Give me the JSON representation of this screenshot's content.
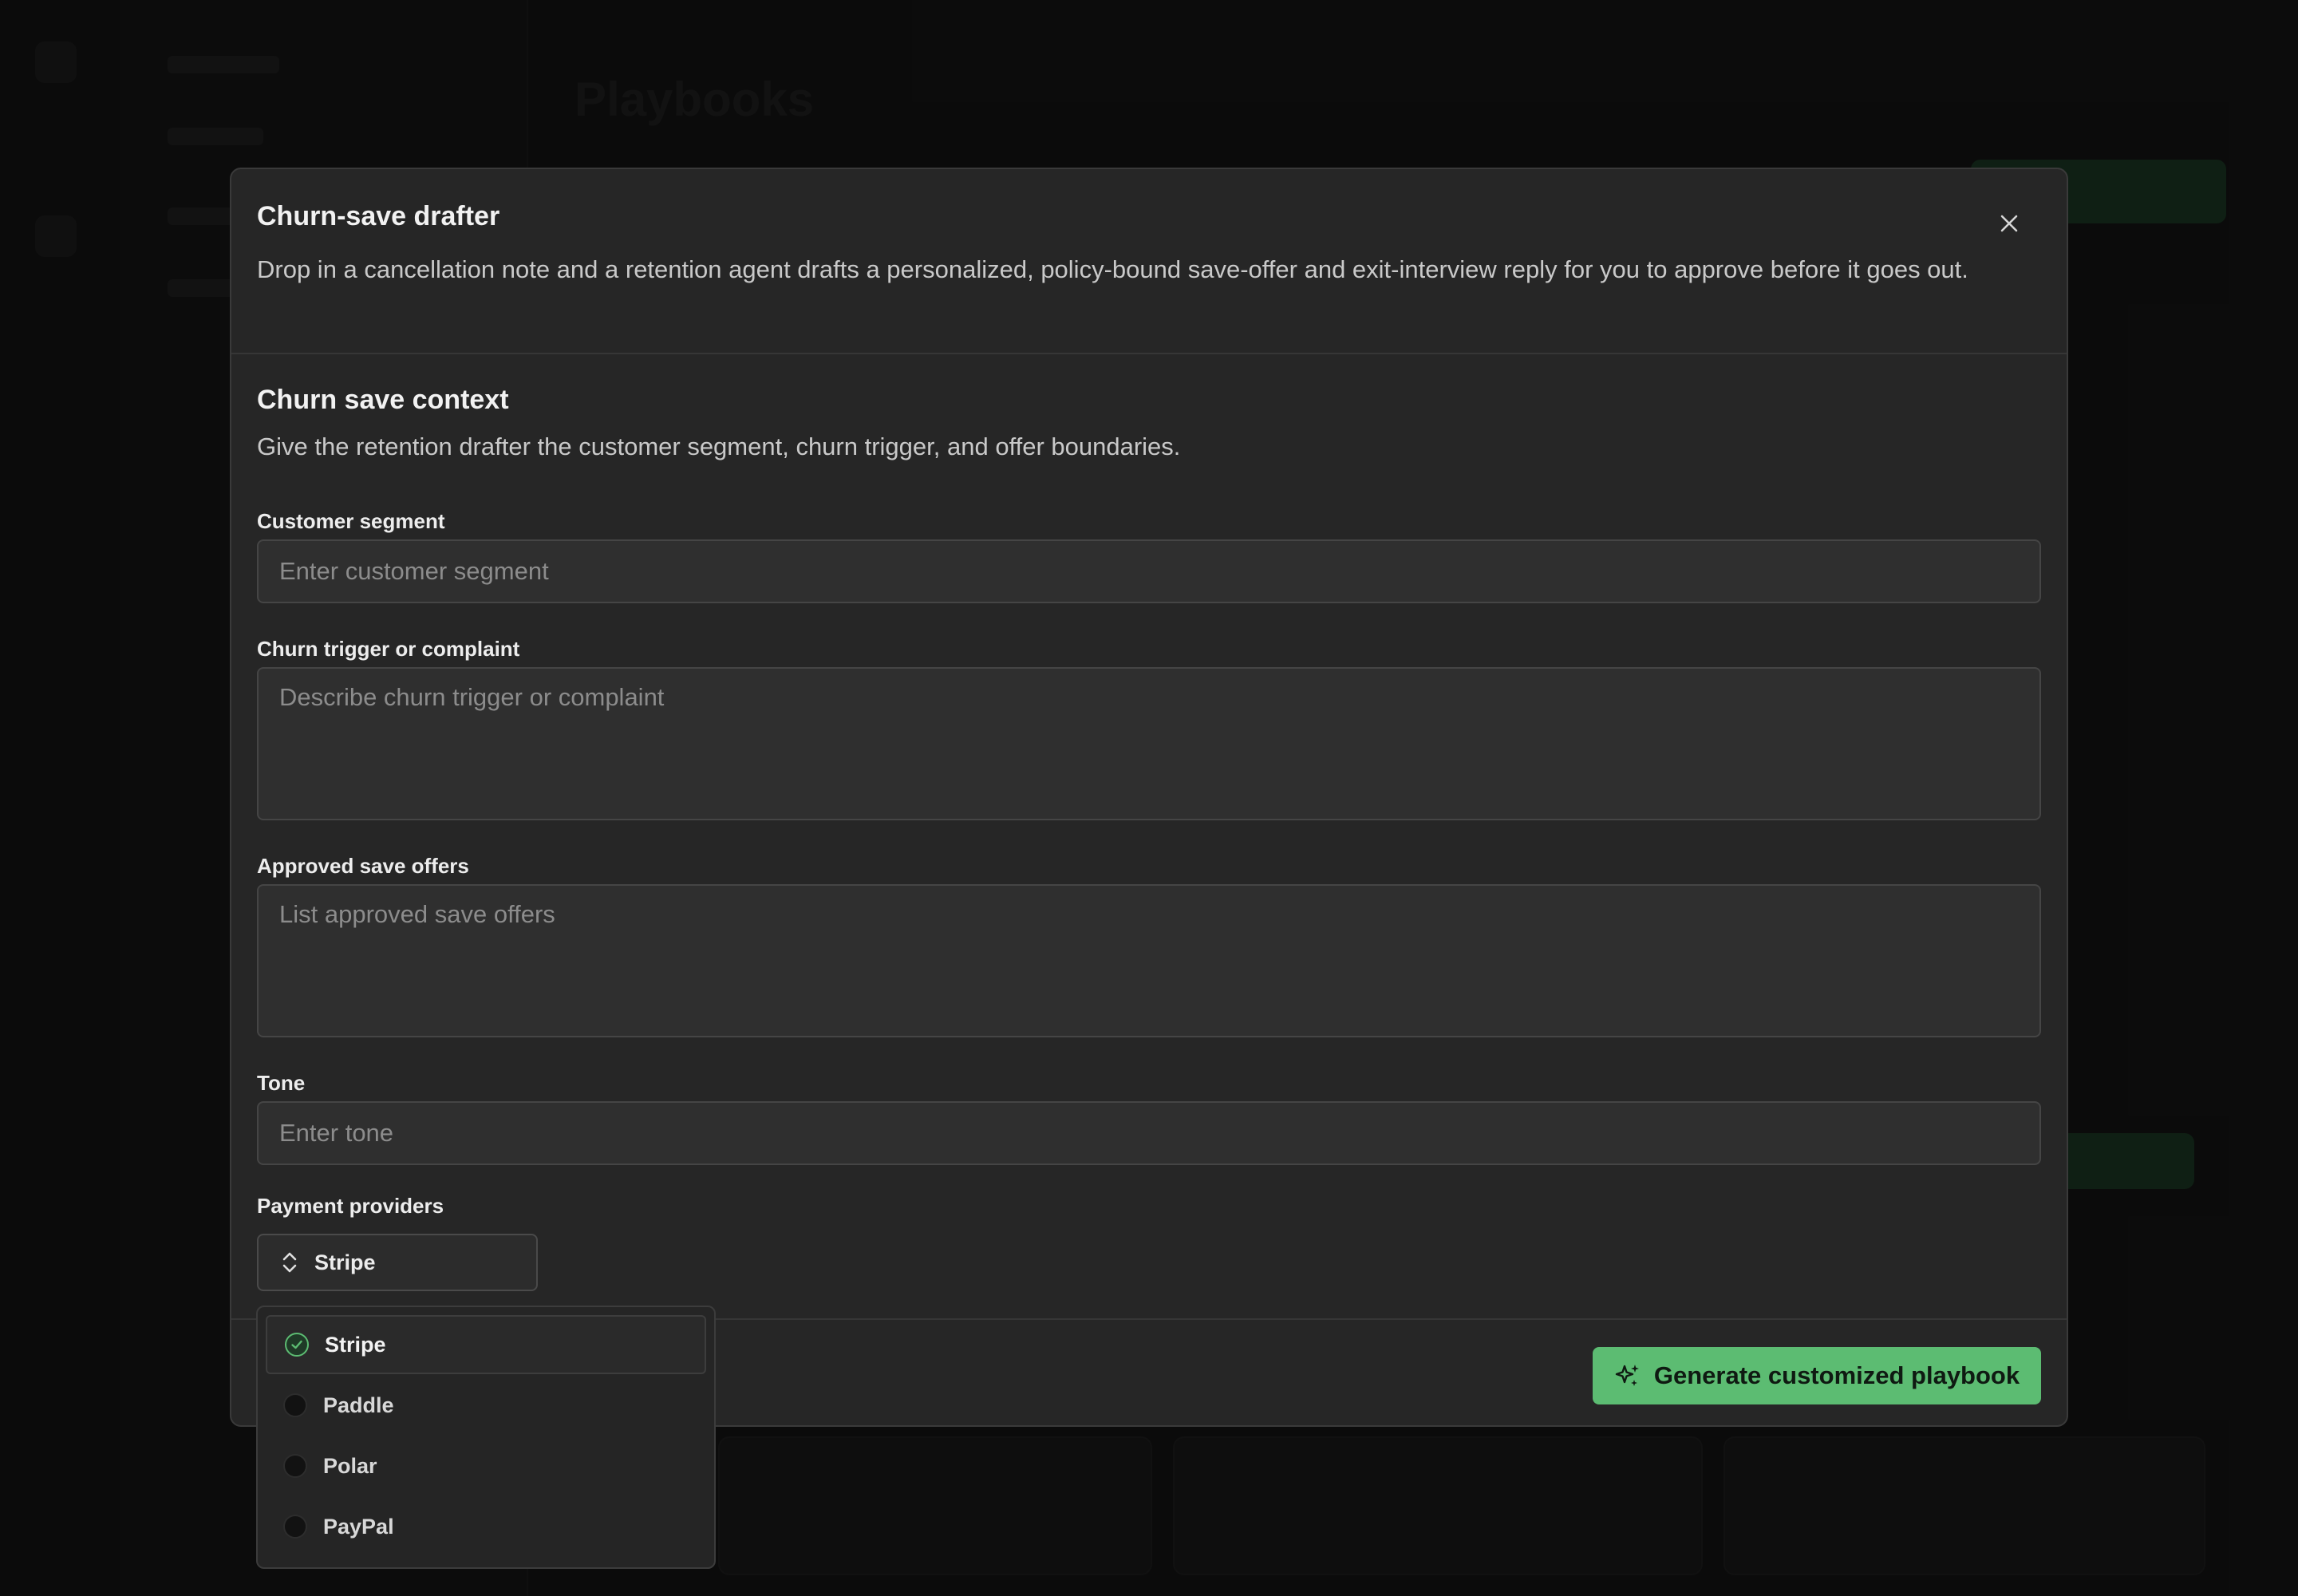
{
  "background": {
    "page_title": "Playbooks"
  },
  "modal": {
    "title": "Churn-save drafter",
    "description": "Drop in a cancellation note and a retention agent drafts a personalized, policy-bound save-offer and exit-interview reply for you to approve before it goes out.",
    "close_icon": "close-icon"
  },
  "section": {
    "title": "Churn save context",
    "description": "Give the retention drafter the customer segment, churn trigger, and offer boundaries."
  },
  "fields": {
    "customer_segment": {
      "label": "Customer segment",
      "placeholder": "Enter customer segment",
      "value": ""
    },
    "churn_trigger": {
      "label": "Churn trigger or complaint",
      "placeholder": "Describe churn trigger or complaint",
      "value": ""
    },
    "save_offers": {
      "label": "Approved save offers",
      "placeholder": "List approved save offers",
      "value": ""
    },
    "tone": {
      "label": "Tone",
      "placeholder": "Enter tone",
      "value": ""
    },
    "payment_providers": {
      "label": "Payment providers",
      "selected": "Stripe",
      "icon": "chevron-up-down-icon",
      "options": [
        {
          "label": "Stripe",
          "checked": true
        },
        {
          "label": "Paddle",
          "checked": false
        },
        {
          "label": "Polar",
          "checked": false
        },
        {
          "label": "PayPal",
          "checked": false
        }
      ]
    }
  },
  "footer": {
    "primary_label": "Generate customized playbook",
    "primary_icon": "sparkle-icon"
  },
  "colors": {
    "accent": "#5cbc72",
    "modal_bg": "#262626",
    "input_bg": "#2f2f2f"
  }
}
